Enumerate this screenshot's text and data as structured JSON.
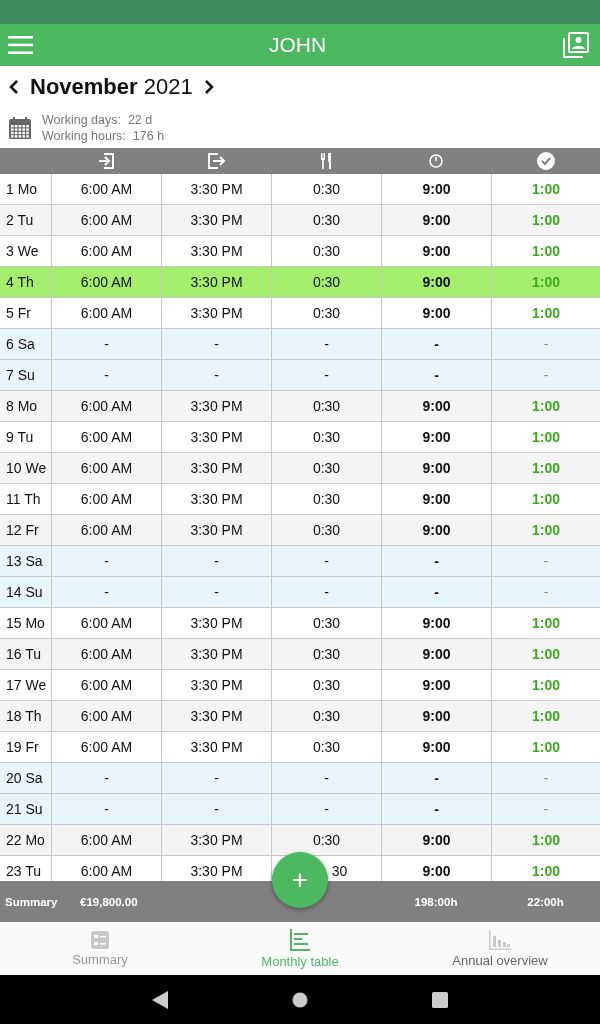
{
  "app_bar": {
    "title": "JOHN"
  },
  "month": {
    "name": "November",
    "year": "2021"
  },
  "info": {
    "working_days_label": "Working days:",
    "working_days": "22 d",
    "working_hours_label": "Working hours:",
    "working_hours": "176 h"
  },
  "rows": [
    {
      "day": "1 Mo",
      "in": "6:00 AM",
      "out": "3:30 PM",
      "break": "0:30",
      "total": "9:00",
      "overtime": "1:00",
      "kind": "workday",
      "selected": false
    },
    {
      "day": "2 Tu",
      "in": "6:00 AM",
      "out": "3:30 PM",
      "break": "0:30",
      "total": "9:00",
      "overtime": "1:00",
      "kind": "workday",
      "selected": false
    },
    {
      "day": "3 We",
      "in": "6:00 AM",
      "out": "3:30 PM",
      "break": "0:30",
      "total": "9:00",
      "overtime": "1:00",
      "kind": "workday",
      "selected": false
    },
    {
      "day": "4 Th",
      "in": "6:00 AM",
      "out": "3:30 PM",
      "break": "0:30",
      "total": "9:00",
      "overtime": "1:00",
      "kind": "workday",
      "selected": true
    },
    {
      "day": "5 Fr",
      "in": "6:00 AM",
      "out": "3:30 PM",
      "break": "0:30",
      "total": "9:00",
      "overtime": "1:00",
      "kind": "workday",
      "selected": false
    },
    {
      "day": "6 Sa",
      "in": "-",
      "out": "-",
      "break": "-",
      "total": "-",
      "overtime": "-",
      "kind": "weekend",
      "selected": false
    },
    {
      "day": "7 Su",
      "in": "-",
      "out": "-",
      "break": "-",
      "total": "-",
      "overtime": "-",
      "kind": "weekend",
      "selected": false
    },
    {
      "day": "8 Mo",
      "in": "6:00 AM",
      "out": "3:30 PM",
      "break": "0:30",
      "total": "9:00",
      "overtime": "1:00",
      "kind": "workday",
      "selected": false
    },
    {
      "day": "9 Tu",
      "in": "6:00 AM",
      "out": "3:30 PM",
      "break": "0:30",
      "total": "9:00",
      "overtime": "1:00",
      "kind": "workday",
      "selected": false
    },
    {
      "day": "10 We",
      "in": "6:00 AM",
      "out": "3:30 PM",
      "break": "0:30",
      "total": "9:00",
      "overtime": "1:00",
      "kind": "workday",
      "selected": false
    },
    {
      "day": "11 Th",
      "in": "6:00 AM",
      "out": "3:30 PM",
      "break": "0:30",
      "total": "9:00",
      "overtime": "1:00",
      "kind": "workday",
      "selected": false
    },
    {
      "day": "12 Fr",
      "in": "6:00 AM",
      "out": "3:30 PM",
      "break": "0:30",
      "total": "9:00",
      "overtime": "1:00",
      "kind": "workday",
      "selected": false
    },
    {
      "day": "13 Sa",
      "in": "-",
      "out": "-",
      "break": "-",
      "total": "-",
      "overtime": "-",
      "kind": "weekend",
      "selected": false
    },
    {
      "day": "14 Su",
      "in": "-",
      "out": "-",
      "break": "-",
      "total": "-",
      "overtime": "-",
      "kind": "weekend",
      "selected": false
    },
    {
      "day": "15 Mo",
      "in": "6:00 AM",
      "out": "3:30 PM",
      "break": "0:30",
      "total": "9:00",
      "overtime": "1:00",
      "kind": "workday",
      "selected": false
    },
    {
      "day": "16 Tu",
      "in": "6:00 AM",
      "out": "3:30 PM",
      "break": "0:30",
      "total": "9:00",
      "overtime": "1:00",
      "kind": "workday",
      "selected": false
    },
    {
      "day": "17 We",
      "in": "6:00 AM",
      "out": "3:30 PM",
      "break": "0:30",
      "total": "9:00",
      "overtime": "1:00",
      "kind": "workday",
      "selected": false
    },
    {
      "day": "18 Th",
      "in": "6:00 AM",
      "out": "3:30 PM",
      "break": "0:30",
      "total": "9:00",
      "overtime": "1:00",
      "kind": "workday",
      "selected": false
    },
    {
      "day": "19 Fr",
      "in": "6:00 AM",
      "out": "3:30 PM",
      "break": "0:30",
      "total": "9:00",
      "overtime": "1:00",
      "kind": "workday",
      "selected": false
    },
    {
      "day": "20 Sa",
      "in": "-",
      "out": "-",
      "break": "-",
      "total": "-",
      "overtime": "-",
      "kind": "weekend",
      "selected": false
    },
    {
      "day": "21 Su",
      "in": "-",
      "out": "-",
      "break": "-",
      "total": "-",
      "overtime": "-",
      "kind": "weekend",
      "selected": false
    },
    {
      "day": "22 Mo",
      "in": "6:00 AM",
      "out": "3:30 PM",
      "break": "0:30",
      "total": "9:00",
      "overtime": "1:00",
      "kind": "workday",
      "selected": false
    },
    {
      "day": "23 Tu",
      "in": "6:00 AM",
      "out": "3:30 PM",
      "break": "30",
      "total": "9:00",
      "overtime": "1:00",
      "kind": "workday",
      "selected": false
    }
  ],
  "summary": {
    "label": "Summary",
    "amount": "€19,800.00",
    "total": "198:00h",
    "overtime": "22:00h"
  },
  "fab": {
    "label": "+"
  },
  "bottom_nav": [
    {
      "label": "Summary",
      "selected": false,
      "disabled": true
    },
    {
      "label": "Monthly table",
      "selected": true,
      "disabled": false
    },
    {
      "label": "Annual overview",
      "selected": false,
      "disabled": false
    }
  ]
}
